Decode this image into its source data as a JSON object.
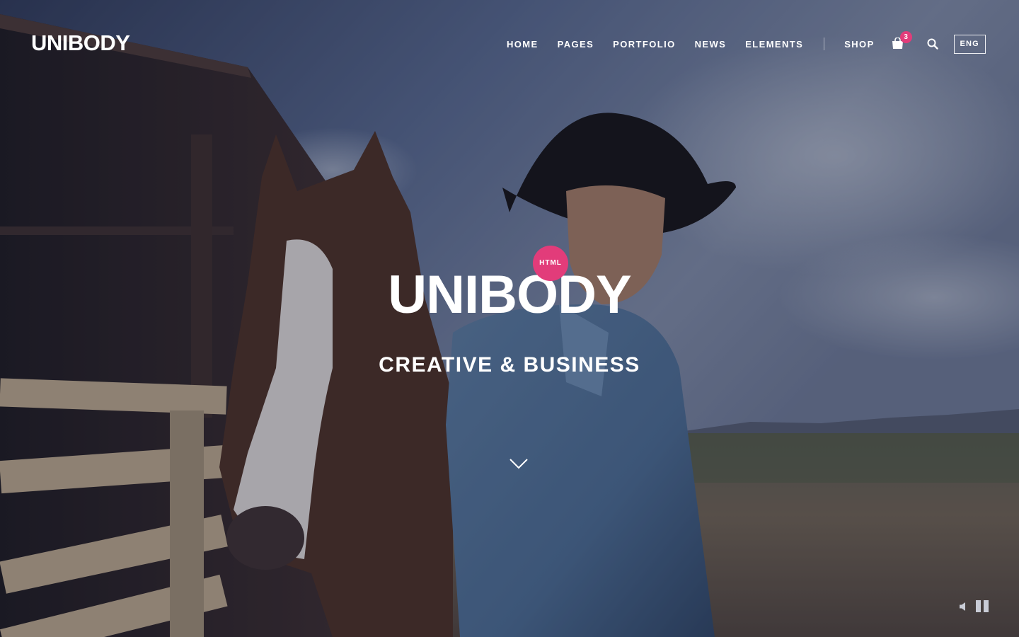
{
  "header": {
    "logo_text": "UNIBODY",
    "nav": [
      {
        "label": "HOME"
      },
      {
        "label": "PAGES"
      },
      {
        "label": "PORTFOLIO"
      },
      {
        "label": "NEWS"
      },
      {
        "label": "ELEMENTS"
      }
    ],
    "shop_label": "SHOP",
    "cart_count": "3",
    "lang_label": "ENG",
    "icons": {
      "cart": "shopping-bag-icon",
      "search": "search-icon"
    }
  },
  "hero": {
    "badge": "HTML",
    "title": "UNIBODY",
    "subtitle": "CREATIVE & BUSINESS",
    "scroll_icon": "chevron-down-icon"
  },
  "video_controls": {
    "mute_icon": "volume-icon",
    "pause_icon": "pause-icon"
  },
  "colors": {
    "accent": "#e23c7a",
    "text": "#ffffff"
  }
}
